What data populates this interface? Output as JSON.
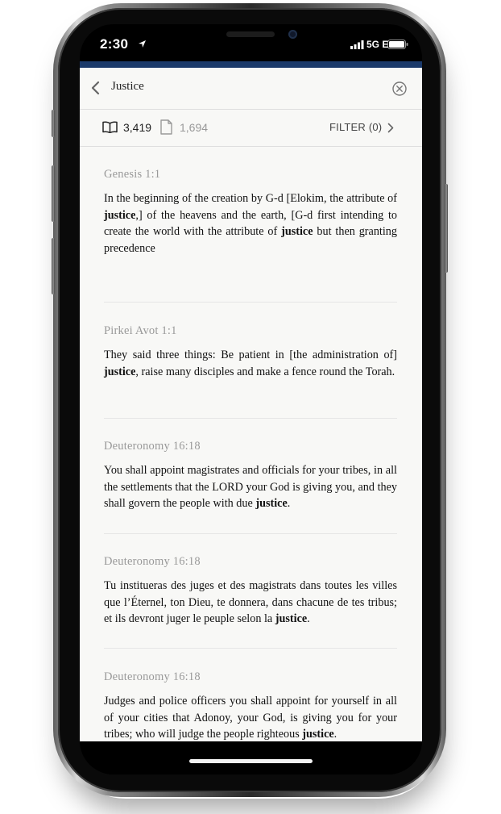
{
  "status_bar": {
    "time": "2:30",
    "network": "5G E"
  },
  "search": {
    "query": "Justice"
  },
  "toolbar": {
    "text_count": "3,419",
    "sheet_count": "1,694",
    "filter_label": "FILTER (0)"
  },
  "results": [
    {
      "ref": "Genesis 1:1",
      "segments": [
        {
          "t": "In the beginning of the creation by G-d [Elokim, the attribute of ",
          "b": false
        },
        {
          "t": "justice",
          "b": true
        },
        {
          "t": ",] of the heavens and the earth, [G-d first intending to create the world with the attribute of ",
          "b": false
        },
        {
          "t": "justice",
          "b": true
        },
        {
          "t": " but then granting precedence",
          "b": false
        }
      ]
    },
    {
      "ref": "Pirkei Avot 1:1",
      "segments": [
        {
          "t": "They said three things:  Be patient in [the administration of] ",
          "b": false
        },
        {
          "t": "justice",
          "b": true
        },
        {
          "t": ", raise many disciples and make a fence round the Torah.",
          "b": false
        }
      ]
    },
    {
      "ref": "Deuteronomy 16:18",
      "segments": [
        {
          "t": "You shall appoint magistrates and officials for your tribes, in all the settlements that the LORD your God is giving you, and they shall govern the people with due ",
          "b": false
        },
        {
          "t": "justice",
          "b": true
        },
        {
          "t": ".",
          "b": false
        }
      ]
    },
    {
      "ref": "Deuteronomy 16:18",
      "segments": [
        {
          "t": "Tu institueras des juges et des magistrats dans toutes les villes que l’Éternel, ton Dieu, te donnera, dans chacune de tes tribus; et ils devront juger le peuple selon la ",
          "b": false
        },
        {
          "t": "justice",
          "b": true
        },
        {
          "t": ".",
          "b": false
        }
      ]
    },
    {
      "ref": "Deuteronomy 16:18",
      "segments": [
        {
          "t": "Judges and police officers you shall appoint for yourself in all of your cities that Adonoy, your God, is giving you for your tribes; who will judge the people righteous ",
          "b": false
        },
        {
          "t": "justice",
          "b": true
        },
        {
          "t": ".",
          "b": false
        }
      ]
    }
  ],
  "colors": {
    "accent": "#1b3a6b",
    "background": "#f8f8f6",
    "reference_text": "#999999",
    "body_text": "#111111"
  },
  "icons": {
    "back": "chevron-left-icon",
    "clear": "close-circle-icon",
    "text_results": "book-icon",
    "sheet_results": "sheet-icon",
    "filter": "chevron-right-icon"
  }
}
